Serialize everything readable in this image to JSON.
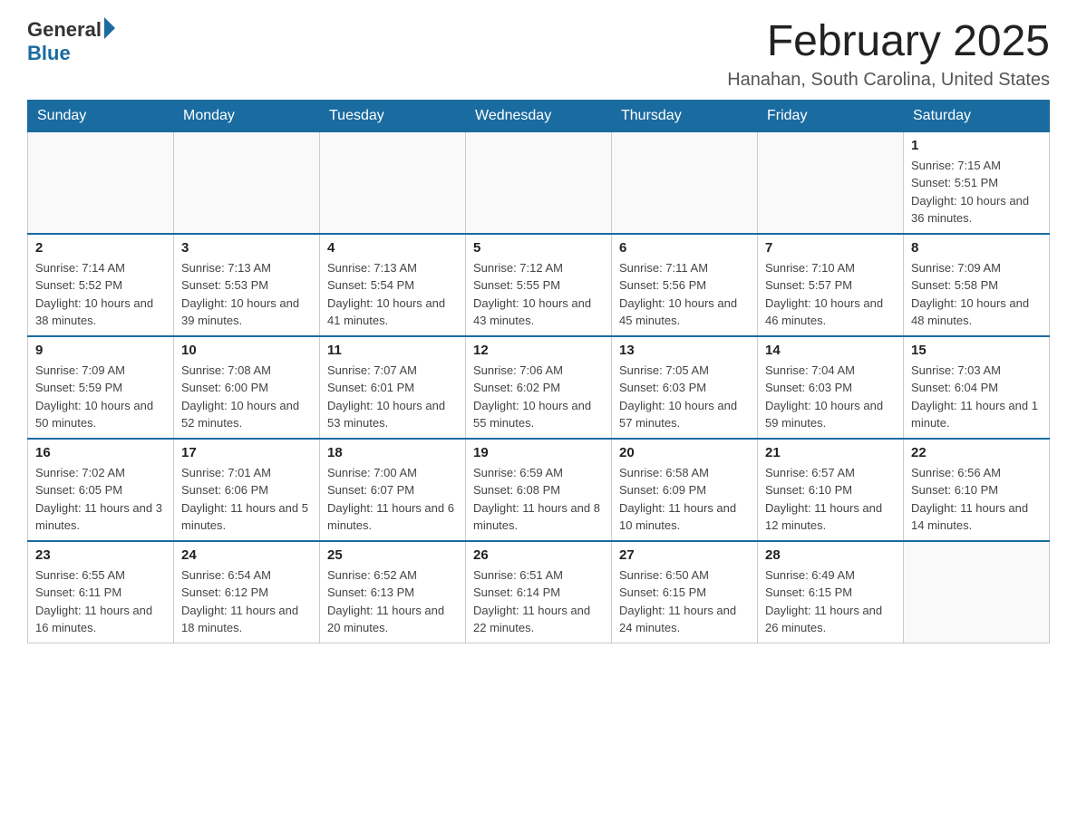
{
  "logo": {
    "general": "General",
    "blue": "Blue"
  },
  "title": "February 2025",
  "location": "Hanahan, South Carolina, United States",
  "weekdays": [
    "Sunday",
    "Monday",
    "Tuesday",
    "Wednesday",
    "Thursday",
    "Friday",
    "Saturday"
  ],
  "weeks": [
    [
      {
        "day": "",
        "info": ""
      },
      {
        "day": "",
        "info": ""
      },
      {
        "day": "",
        "info": ""
      },
      {
        "day": "",
        "info": ""
      },
      {
        "day": "",
        "info": ""
      },
      {
        "day": "",
        "info": ""
      },
      {
        "day": "1",
        "info": "Sunrise: 7:15 AM\nSunset: 5:51 PM\nDaylight: 10 hours and 36 minutes."
      }
    ],
    [
      {
        "day": "2",
        "info": "Sunrise: 7:14 AM\nSunset: 5:52 PM\nDaylight: 10 hours and 38 minutes."
      },
      {
        "day": "3",
        "info": "Sunrise: 7:13 AM\nSunset: 5:53 PM\nDaylight: 10 hours and 39 minutes."
      },
      {
        "day": "4",
        "info": "Sunrise: 7:13 AM\nSunset: 5:54 PM\nDaylight: 10 hours and 41 minutes."
      },
      {
        "day": "5",
        "info": "Sunrise: 7:12 AM\nSunset: 5:55 PM\nDaylight: 10 hours and 43 minutes."
      },
      {
        "day": "6",
        "info": "Sunrise: 7:11 AM\nSunset: 5:56 PM\nDaylight: 10 hours and 45 minutes."
      },
      {
        "day": "7",
        "info": "Sunrise: 7:10 AM\nSunset: 5:57 PM\nDaylight: 10 hours and 46 minutes."
      },
      {
        "day": "8",
        "info": "Sunrise: 7:09 AM\nSunset: 5:58 PM\nDaylight: 10 hours and 48 minutes."
      }
    ],
    [
      {
        "day": "9",
        "info": "Sunrise: 7:09 AM\nSunset: 5:59 PM\nDaylight: 10 hours and 50 minutes."
      },
      {
        "day": "10",
        "info": "Sunrise: 7:08 AM\nSunset: 6:00 PM\nDaylight: 10 hours and 52 minutes."
      },
      {
        "day": "11",
        "info": "Sunrise: 7:07 AM\nSunset: 6:01 PM\nDaylight: 10 hours and 53 minutes."
      },
      {
        "day": "12",
        "info": "Sunrise: 7:06 AM\nSunset: 6:02 PM\nDaylight: 10 hours and 55 minutes."
      },
      {
        "day": "13",
        "info": "Sunrise: 7:05 AM\nSunset: 6:03 PM\nDaylight: 10 hours and 57 minutes."
      },
      {
        "day": "14",
        "info": "Sunrise: 7:04 AM\nSunset: 6:03 PM\nDaylight: 10 hours and 59 minutes."
      },
      {
        "day": "15",
        "info": "Sunrise: 7:03 AM\nSunset: 6:04 PM\nDaylight: 11 hours and 1 minute."
      }
    ],
    [
      {
        "day": "16",
        "info": "Sunrise: 7:02 AM\nSunset: 6:05 PM\nDaylight: 11 hours and 3 minutes."
      },
      {
        "day": "17",
        "info": "Sunrise: 7:01 AM\nSunset: 6:06 PM\nDaylight: 11 hours and 5 minutes."
      },
      {
        "day": "18",
        "info": "Sunrise: 7:00 AM\nSunset: 6:07 PM\nDaylight: 11 hours and 6 minutes."
      },
      {
        "day": "19",
        "info": "Sunrise: 6:59 AM\nSunset: 6:08 PM\nDaylight: 11 hours and 8 minutes."
      },
      {
        "day": "20",
        "info": "Sunrise: 6:58 AM\nSunset: 6:09 PM\nDaylight: 11 hours and 10 minutes."
      },
      {
        "day": "21",
        "info": "Sunrise: 6:57 AM\nSunset: 6:10 PM\nDaylight: 11 hours and 12 minutes."
      },
      {
        "day": "22",
        "info": "Sunrise: 6:56 AM\nSunset: 6:10 PM\nDaylight: 11 hours and 14 minutes."
      }
    ],
    [
      {
        "day": "23",
        "info": "Sunrise: 6:55 AM\nSunset: 6:11 PM\nDaylight: 11 hours and 16 minutes."
      },
      {
        "day": "24",
        "info": "Sunrise: 6:54 AM\nSunset: 6:12 PM\nDaylight: 11 hours and 18 minutes."
      },
      {
        "day": "25",
        "info": "Sunrise: 6:52 AM\nSunset: 6:13 PM\nDaylight: 11 hours and 20 minutes."
      },
      {
        "day": "26",
        "info": "Sunrise: 6:51 AM\nSunset: 6:14 PM\nDaylight: 11 hours and 22 minutes."
      },
      {
        "day": "27",
        "info": "Sunrise: 6:50 AM\nSunset: 6:15 PM\nDaylight: 11 hours and 24 minutes."
      },
      {
        "day": "28",
        "info": "Sunrise: 6:49 AM\nSunset: 6:15 PM\nDaylight: 11 hours and 26 minutes."
      },
      {
        "day": "",
        "info": ""
      }
    ]
  ]
}
